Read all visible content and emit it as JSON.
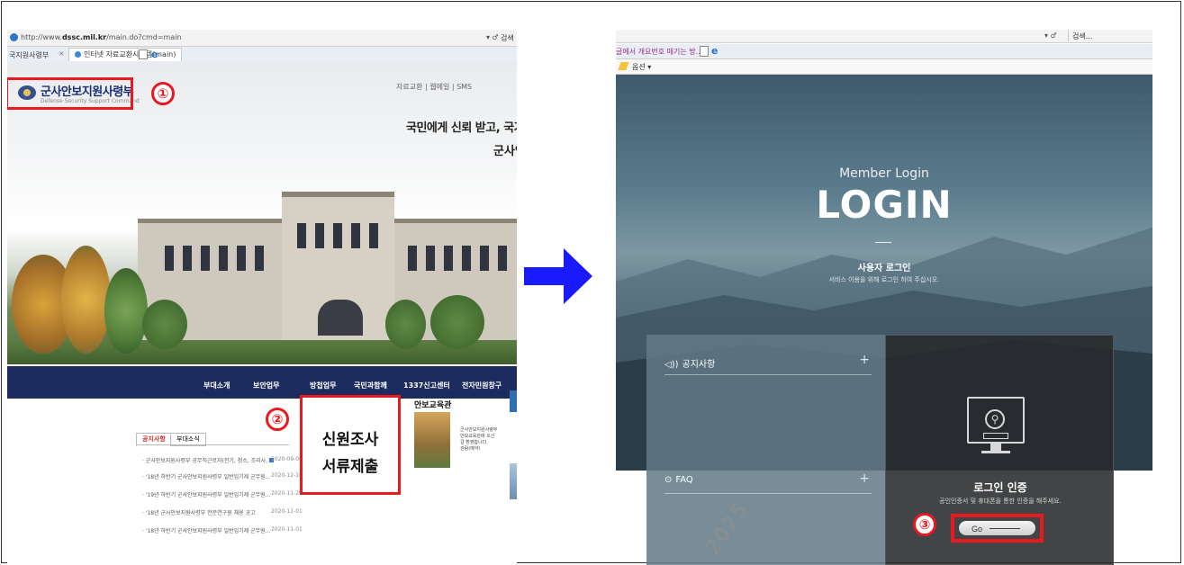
{
  "left": {
    "browser": {
      "url_prefix": "http://www.",
      "url_domain": "dssc.mil.kr",
      "url_path": "/main.do?cmd=main",
      "refresh": "▾ ♂",
      "search": "검색",
      "tab1": "국지원사령부",
      "tab_close": "×",
      "tab2": "인터넷 자료교환시스템(main)"
    },
    "site": {
      "logo_text": "군사안보지원사령부",
      "logo_sub": "Defense Security Support Command",
      "top_links": "자료교환 | 웹메일 | SMS",
      "slogan_line1": "국민에게 신뢰 받고, 국가안보",
      "slogan_line2": "군사안",
      "nav": [
        "부대소개",
        "보안업무",
        "방첩업무",
        "국민과함께",
        "1337신고센터",
        "전자민원창구"
      ],
      "tabs": [
        "공지사항",
        "부대소식"
      ],
      "notices": [
        {
          "title": "· 군사안보지원사령부 공무직근로자(전기, 청소, 조리사,",
          "date": "2020-09-08",
          "badge": true
        },
        {
          "title": "· '18년 하반기 군사안보지원사령부 일반임기제 군무원...",
          "date": "2020-12-16"
        },
        {
          "title": "· '19년 하반기 군사안보지원사령부 일반임기제 군무원...",
          "date": "2020-11-29"
        },
        {
          "title": "· '18년 군사안보지원사령부 전문연구원 채용 공고",
          "date": "2020-11-01"
        },
        {
          "title": "· '18년 하반기 군사안보지원사령부 일반임기제 군무원...",
          "date": "2020-11-01"
        }
      ],
      "edu_title": "안보교육관",
      "edu_desc": [
        "군사안보지원사령부",
        "안보교육관에 오신",
        "걸 환영합니다.",
        "관람(예약)"
      ]
    },
    "callout": {
      "line1": "신원조사",
      "line2": "서류제출"
    },
    "markers": {
      "one": "①",
      "two": "②"
    }
  },
  "right": {
    "browser": {
      "refresh": "▾ ♂",
      "search": "검색...",
      "tab1": "글에서 개요번호 매기는 방...",
      "options": "옵션 ▾"
    },
    "login": {
      "member": "Member Login",
      "title": "LOGIN",
      "user_login": "사용자 로그인",
      "hint": "서비스 이용을 위해 로그인 하여 주십시오."
    },
    "left_panel": {
      "rows": [
        {
          "icon": "speaker-icon",
          "glyph": "◁))",
          "label": "공지사항",
          "plus": "+"
        },
        {
          "icon": "chat-icon",
          "glyph": "⊙",
          "label": "FAQ",
          "plus": "+"
        }
      ]
    },
    "right_panel": {
      "title": "로그인 인증",
      "desc": "공인인증서 및 휴대폰을 통한 인증을 해주세요.",
      "go": "Go"
    },
    "markers": {
      "three": "③"
    }
  },
  "arrow": {
    "color": "#1a1aff"
  },
  "accent": {
    "red": "#e8191f",
    "navy": "#1d2c5e"
  },
  "watermark": "2025"
}
